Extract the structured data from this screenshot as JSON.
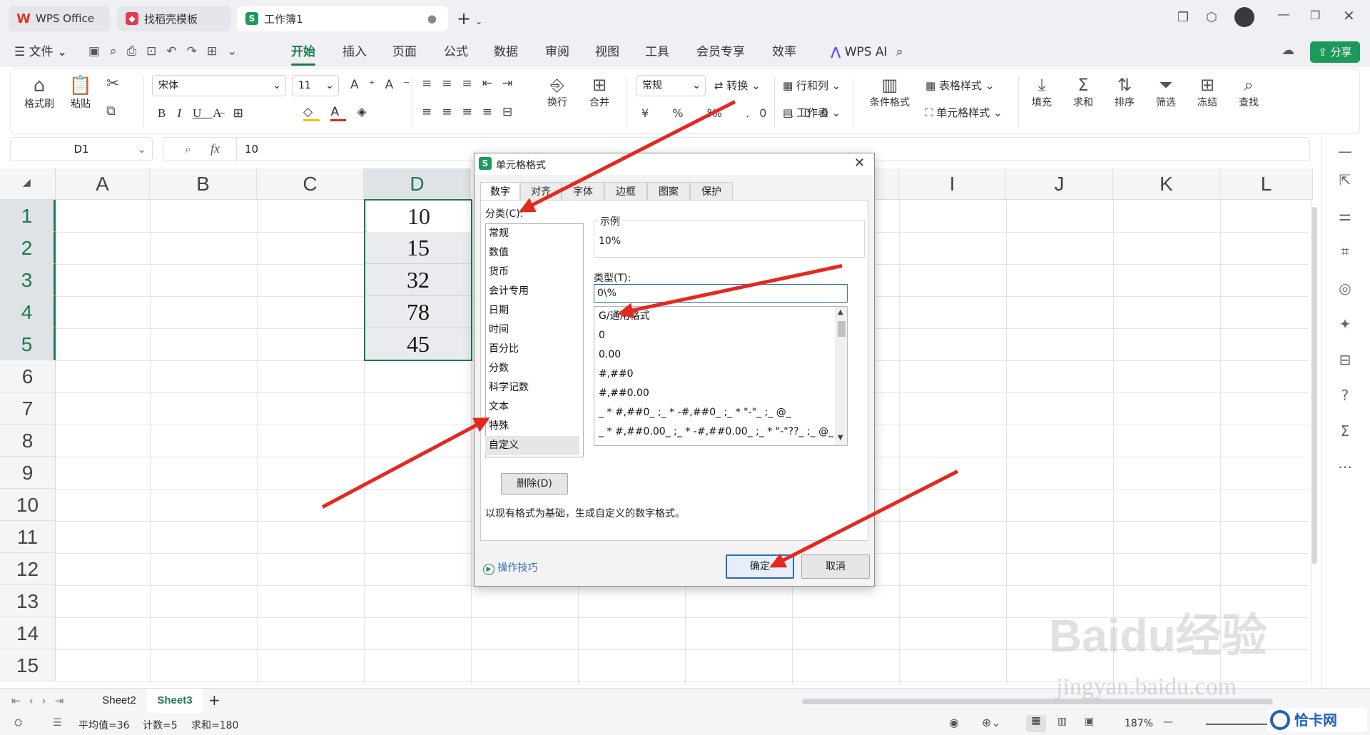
{
  "titlebar": {
    "tabs": [
      {
        "label": "WPS Office",
        "icon": "wps-logo-icon",
        "color": "#d9362c"
      },
      {
        "label": "找稻壳模板",
        "icon": "docer-icon",
        "color": "#e23b4b"
      },
      {
        "label": "工作簿1",
        "icon": "sheet-s-icon",
        "color": "#1d9a5a"
      }
    ],
    "new_tab": "+"
  },
  "menubar": {
    "file": "文件",
    "items": [
      "开始",
      "插入",
      "页面",
      "公式",
      "数据",
      "审阅",
      "视图",
      "工具",
      "会员专享",
      "效率"
    ],
    "wps_ai": "WPS AI",
    "share": "分享"
  },
  "ribbon": {
    "format_painter": "格式刷",
    "paste": "粘贴",
    "font_name": "宋体",
    "font_size": "11",
    "wrap": "换行",
    "merge": "合并",
    "number_format": "常规",
    "convert": "转换",
    "row_col": "行和列",
    "worksheet": "工作表",
    "cond_format": "条件格式",
    "table_style": "表格样式",
    "cell_style": "单元格样式",
    "fill": "填充",
    "sum": "求和",
    "sort": "排序",
    "filter": "筛选",
    "freeze": "冻结",
    "find": "查找"
  },
  "formula_bar": {
    "name_box": "D1",
    "fx": "fx",
    "value": "10"
  },
  "sheet": {
    "columns": [
      "A",
      "B",
      "C",
      "D",
      "I",
      "J",
      "K",
      "L"
    ],
    "rows": [
      "1",
      "2",
      "3",
      "4",
      "5",
      "6",
      "7",
      "8",
      "9",
      "10",
      "11",
      "12",
      "13",
      "14",
      "15"
    ],
    "d_values": [
      "10",
      "15",
      "32",
      "78",
      "45"
    ]
  },
  "dialog": {
    "title": "单元格格式",
    "tabs": [
      "数字",
      "对齐",
      "字体",
      "边框",
      "图案",
      "保护"
    ],
    "category_label": "分类(C):",
    "categories": [
      "常规",
      "数值",
      "货币",
      "会计专用",
      "日期",
      "时间",
      "百分比",
      "分数",
      "科学记数",
      "文本",
      "特殊",
      "自定义"
    ],
    "selected_category": "自定义",
    "sample_label": "示例",
    "sample_value": "10%",
    "type_label": "类型(T):",
    "type_value": "0\\%",
    "formats": [
      "G/通用格式",
      "0",
      "0.00",
      "#,##0",
      "#,##0.00",
      "_ * #,##0_ ;_ * -#,##0_ ;_ * \"-\"_ ;_ @_",
      "_ * #,##0.00_ ;_ * -#,##0.00_ ;_ * \"-\"??_ ;_ @_"
    ],
    "delete_button": "删除(D)",
    "description": "以现有格式为基础，生成自定义的数字格式。",
    "tips": "操作技巧",
    "ok": "确定",
    "cancel": "取消"
  },
  "sheet_tabs": [
    "Sheet2",
    "Sheet3"
  ],
  "status": {
    "average": "平均值=36",
    "count": "计数=5",
    "sum": "求和=180",
    "zoom": "187%"
  },
  "watermark": {
    "text": "jingyan.baidu.com",
    "logo": "Baidu经验",
    "corner": "恰卡网"
  },
  "colors": {
    "accent": "#1d7a4f",
    "arrow": "#e5281e",
    "dialog_focus": "#2b6cb8"
  }
}
